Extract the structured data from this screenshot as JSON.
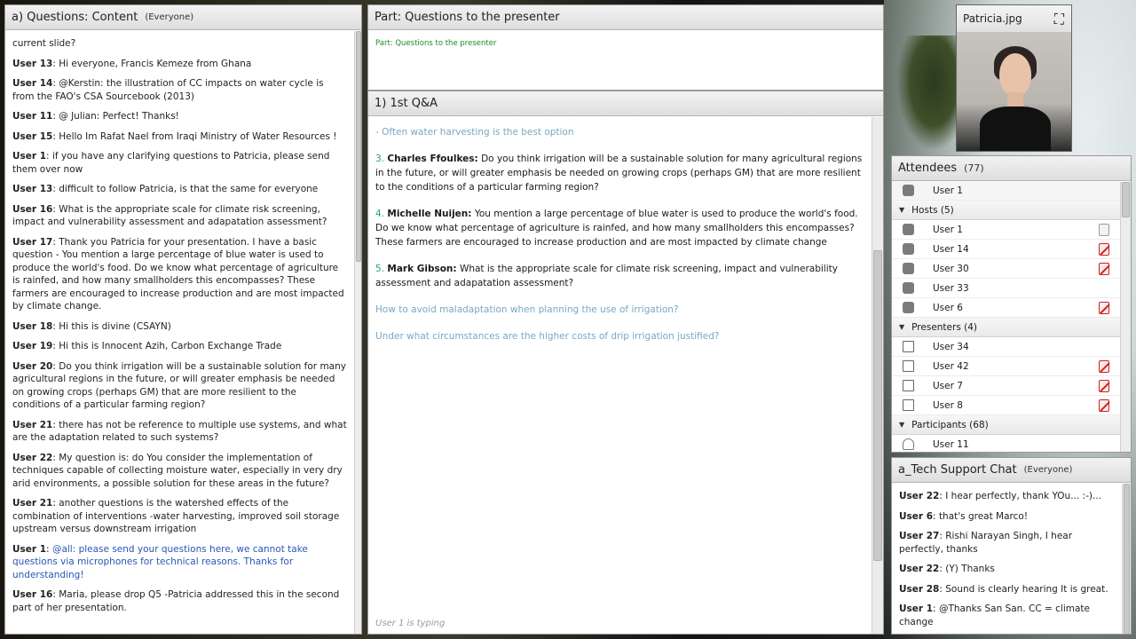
{
  "chat_pod": {
    "title": "a) Questions: Content",
    "scope": "(Everyone)",
    "first_line": "current slide?",
    "messages": [
      {
        "sender": "User 13",
        "text": "Hi everyone, Francis Kemeze from Ghana"
      },
      {
        "sender": "User 14",
        "text": "@Kerstin: the illustration of CC impacts on water cycle is from the FAO's CSA Sourcebook (2013)"
      },
      {
        "sender": "User 11",
        "text": "@ Julian: Perfect! Thanks!"
      },
      {
        "sender": "User 15",
        "text": "Hello Im Rafat Nael from Iraqi Ministry of Water Resources !"
      },
      {
        "sender": "User 1",
        "text": "if you have any clarifying questions to Patricia, please send them over now"
      },
      {
        "sender": "User 13",
        "text": "difficult to follow Patricia, is that the same for everyone"
      },
      {
        "sender": "User 16",
        "text": "What is the appropriate scale for climate risk screening, impact and vulnerability assessment and adapatation assessment?"
      },
      {
        "sender": "User 17",
        "text": "Thank you Patricia for your presentation. I have a basic question - You mention a large percentage of blue water is used to produce the world's food. Do we know what percentage of agriculture is rainfed, and how many smallholders this encompasses? These farmers are encouraged to increase production and are most impacted by climate change."
      },
      {
        "sender": "User 18",
        "text": "Hi this is divine (CSAYN)"
      },
      {
        "sender": "User 19",
        "text": "Hi this is Innocent Azih, Carbon Exchange Trade"
      },
      {
        "sender": "User 20",
        "text": "Do you think irrigation will be a sustainable solution for many agricultural regions in the future, or will greater emphasis be needed on growing crops (perhaps GM) that are more resilient to the conditions of a particular farming region?"
      },
      {
        "sender": "User 21",
        "text": "there has not be reference to multiple use systems, and  what are the adaptation related to such systems?"
      },
      {
        "sender": "User 22",
        "text": "My question is: do You consider the implementation of techniques capable of collecting moisture water, especially in very dry arid environments, a possible solution for these areas in the future?"
      },
      {
        "sender": "User 21",
        "text": "another questions is the watershed effects of the combination of interventions -water harvesting, improved soil storage upstream versus downstream irrigation"
      },
      {
        "sender": "User 1",
        "text": "@all: please send your questions here, we cannot take questions via microphones for technical reasons. Thanks for understanding!",
        "host": true
      },
      {
        "sender": "User 16",
        "text": "Maria, please drop Q5 -Patricia addressed this in the second part of her presentation."
      }
    ]
  },
  "notes_top": {
    "title": "Part: Questions to the presenter",
    "body": "Part: Questions to the presenter"
  },
  "notes_main": {
    "title": "1) 1st Q&A",
    "items": [
      {
        "num": "",
        "name": "",
        "text": "- Often water harvesting is the best option",
        "faded": true
      },
      {
        "num": "3.",
        "name": "Charles Ffoulkes:",
        "text": "Do you think irrigation will be a sustainable solution for many agricultural regions in the future, or will greater emphasis be needed on growing crops (perhaps GM) that are more resilient to the conditions of a particular farming region?",
        "faded": false
      },
      {
        "num": "4.",
        "name": "Michelle Nuijen:",
        "text": "You mention a large percentage of blue water is used to produce the world's food. Do we know what percentage of agriculture is rainfed, and how many smallholders this encompasses? These farmers are encouraged to increase production and are most impacted by climate change",
        "faded": false
      },
      {
        "num": "5.",
        "name": "Mark Gibson:",
        "text": "What is the appropriate scale for climate risk screening, impact and vulnerability assessment and adapatation assessment?",
        "faded": false
      },
      {
        "num": "",
        "name": "",
        "text": "How to avoid maladaptation when planning the use of irrigation?",
        "faded": true
      },
      {
        "num": "",
        "name": "",
        "text": "Under what circumstances are the higher costs of drip irrigation justified?",
        "faded": true
      }
    ],
    "typing": "User 1 is typing"
  },
  "camera": {
    "title": "Patricia.jpg",
    "fullscreen_icon": "fullscreen-icon"
  },
  "attendees": {
    "title": "Attendees",
    "count": "(77)",
    "current_user": "User 1",
    "groups": [
      {
        "label": "Hosts (5)",
        "role": "host",
        "users": [
          {
            "name": "User 1",
            "status": "cam"
          },
          {
            "name": "User 14",
            "status": "mic-off"
          },
          {
            "name": "User 30",
            "status": "mic-off"
          },
          {
            "name": "User 33",
            "status": ""
          },
          {
            "name": "User 6",
            "status": "mic-off"
          }
        ]
      },
      {
        "label": "Presenters (4)",
        "role": "presenter",
        "users": [
          {
            "name": "User 34",
            "status": ""
          },
          {
            "name": "User 42",
            "status": "mic-off"
          },
          {
            "name": "User 7",
            "status": "mic-off"
          },
          {
            "name": "User 8",
            "status": "mic-off"
          }
        ]
      },
      {
        "label": "Participants (68)",
        "role": "participant",
        "users": [
          {
            "name": "User 11",
            "status": ""
          }
        ]
      }
    ]
  },
  "tech_chat": {
    "title": "a_Tech Support Chat",
    "scope": "(Everyone)",
    "messages": [
      {
        "sender": "User 22",
        "text": "I hear perfectly, thank YOu... :-)..."
      },
      {
        "sender": "User 6",
        "text": "that's great Marco!"
      },
      {
        "sender": "User 27",
        "text": "Rishi Narayan Singh, I hear perfectly, thanks"
      },
      {
        "sender": "User 22",
        "text": "(Y) Thanks"
      },
      {
        "sender": "User 28",
        "text": "Sound is clearly hearing  It is great."
      },
      {
        "sender": "User 1",
        "text": "@Thanks San San. CC = climate change"
      }
    ]
  },
  "colors": {
    "host_text": "#2a56b5",
    "note_green": "#1f8a2a",
    "faded_blue": "#7aa7c4",
    "mic_red": "#cc2222"
  }
}
